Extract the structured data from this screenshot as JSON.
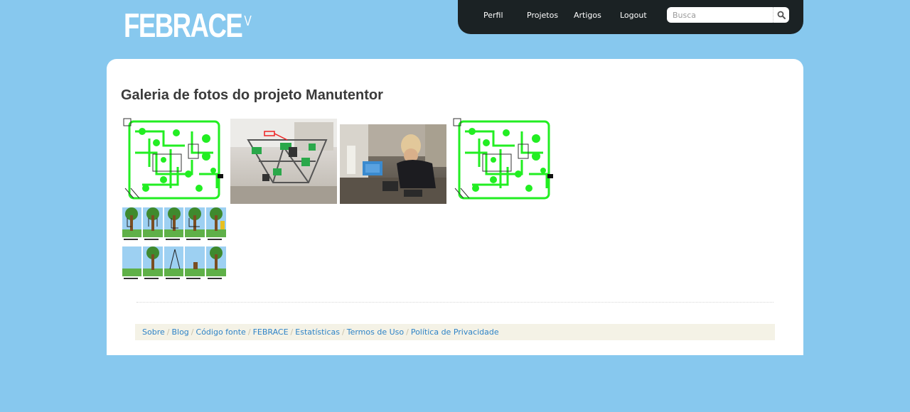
{
  "brand": {
    "name": "FEBRACE",
    "superscript": "V"
  },
  "nav": {
    "items": [
      {
        "label": "Perfil"
      },
      {
        "label": "Projetos"
      },
      {
        "label": "Artigos"
      },
      {
        "label": "Logout"
      }
    ],
    "search": {
      "placeholder": "Busca",
      "value": ""
    },
    "search_icon": "magnifier-icon"
  },
  "page": {
    "title": "Galeria de fotos do projeto Manutentor"
  },
  "gallery": {
    "photos": [
      {
        "kind": "pcb-layout"
      },
      {
        "kind": "3d-printer"
      },
      {
        "kind": "workshop"
      },
      {
        "kind": "pcb-layout"
      },
      {
        "kind": "tree-swing-comic"
      }
    ]
  },
  "footer": {
    "links": [
      {
        "label": "Sobre"
      },
      {
        "label": "Blog"
      },
      {
        "label": "Código fonte"
      },
      {
        "label": "FEBRACE"
      },
      {
        "label": "Estatísticas"
      },
      {
        "label": "Termos de Uso"
      },
      {
        "label": "Política de Privacidade"
      }
    ],
    "separator": "/"
  },
  "colors": {
    "background": "#87c8ee",
    "nav_bar": "#1b2224",
    "link": "#2e83c7",
    "footer_bg": "#f4f2e6",
    "pcb_trace": "#22ee22"
  }
}
